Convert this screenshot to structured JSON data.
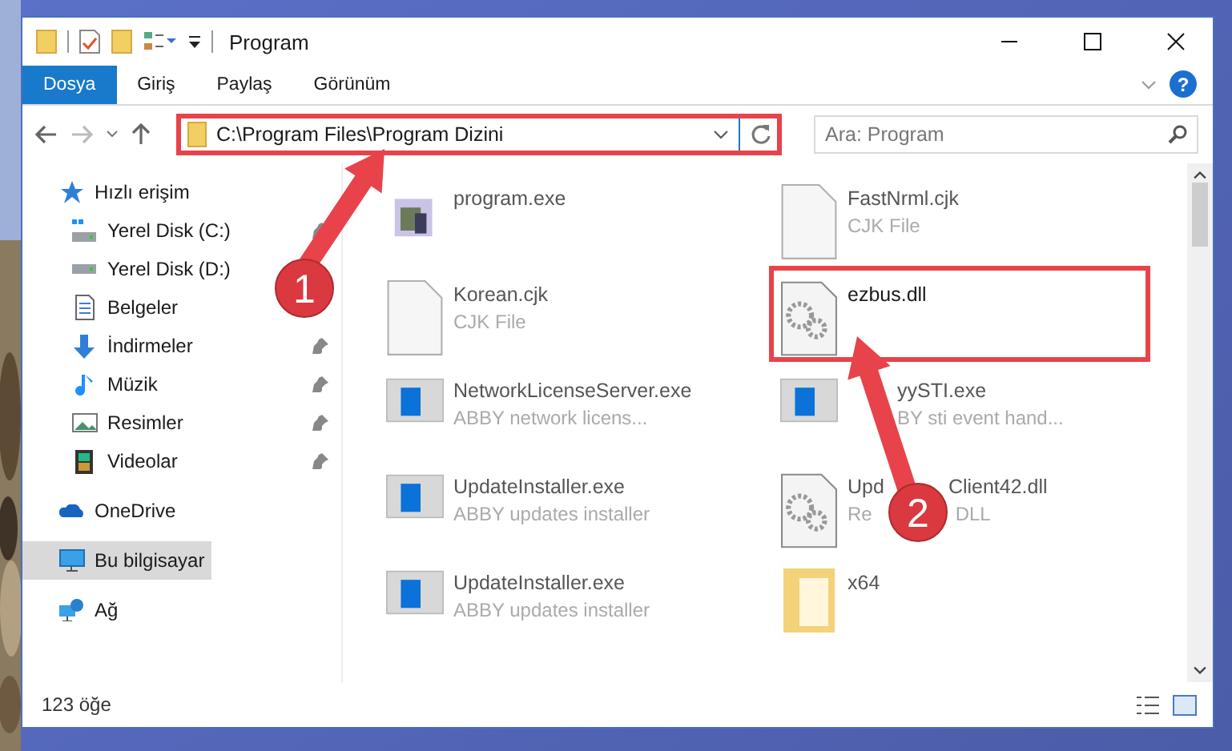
{
  "window": {
    "title": "Program"
  },
  "ribbon_tabs": [
    {
      "label": "Dosya",
      "selected": true
    },
    {
      "label": "Giriş",
      "selected": false
    },
    {
      "label": "Paylaş",
      "selected": false
    },
    {
      "label": "Görünüm",
      "selected": false
    }
  ],
  "help": "?",
  "address": {
    "path": "C:\\Program Files\\Program Dizini",
    "highlighted": true
  },
  "search": {
    "placeholder": "Ara: Program"
  },
  "sidebar": {
    "sections": [
      {
        "kind": "quick",
        "label": "Hızlı erişim",
        "selected": false,
        "children": [
          {
            "kind": "drive-win",
            "label": "Yerel Disk (C:)",
            "pinned": true
          },
          {
            "kind": "drive",
            "label": "Yerel Disk (D:)",
            "pinned": false
          },
          {
            "kind": "docs",
            "label": "Belgeler",
            "pinned": false
          },
          {
            "kind": "download",
            "label": "İndirmeler",
            "pinned": true
          },
          {
            "kind": "music",
            "label": "Müzik",
            "pinned": true
          },
          {
            "kind": "pictures",
            "label": "Resimler",
            "pinned": true
          },
          {
            "kind": "video",
            "label": "Videolar",
            "pinned": true
          }
        ]
      },
      {
        "kind": "cloud",
        "label": "OneDrive",
        "selected": false
      },
      {
        "kind": "pc",
        "label": "Bu bilgisayar",
        "selected": true
      },
      {
        "kind": "network",
        "label": "Ağ",
        "selected": false
      }
    ]
  },
  "files": [
    {
      "kind": "setup",
      "name_parts": [
        "program.exe"
      ],
      "covered": false,
      "highlighted": false
    },
    {
      "kind": "blank",
      "name_parts": [
        "FastNrml.cjk"
      ],
      "detail_parts": [
        "CJK File"
      ],
      "covered": false,
      "highlighted": false
    },
    {
      "kind": "blank",
      "name_parts": [
        "Korean.cjk"
      ],
      "detail_parts": [
        "CJK File"
      ],
      "covered": false,
      "highlighted": false
    },
    {
      "kind": "dll",
      "name_parts": [
        "ezbus.dll"
      ],
      "covered": false,
      "highlighted": true
    },
    {
      "kind": "app",
      "name_parts": [
        "NetworkLicenseServer.exe"
      ],
      "detail_parts": [
        "ABBY network licens..."
      ],
      "covered": false,
      "highlighted": false
    },
    {
      "kind": "app",
      "name_parts": [
        "yySTI.exe"
      ],
      "detail_parts": [
        "BY sti event hand..."
      ],
      "covered": true,
      "highlighted": false
    },
    {
      "kind": "app",
      "name_parts": [
        "UpdateInstaller.exe"
      ],
      "detail_parts": [
        "ABBY updates installer"
      ],
      "covered": false,
      "highlighted": false
    },
    {
      "kind": "dll",
      "name_parts": [
        "Upd",
        "Client42.dll"
      ],
      "detail_parts": [
        "Re",
        "DLL"
      ],
      "covered": false,
      "highlighted": false
    },
    {
      "kind": "app",
      "name_parts": [
        "UpdateInstaller.exe"
      ],
      "detail_parts": [
        "ABBY updates installer"
      ],
      "covered": false,
      "highlighted": false
    },
    {
      "kind": "folder",
      "name_parts": [
        "x64"
      ],
      "covered": false,
      "highlighted": false
    }
  ],
  "status_bar": {
    "count": "123 öğe"
  },
  "annotations": {
    "steps": [
      "1",
      "2"
    ]
  }
}
